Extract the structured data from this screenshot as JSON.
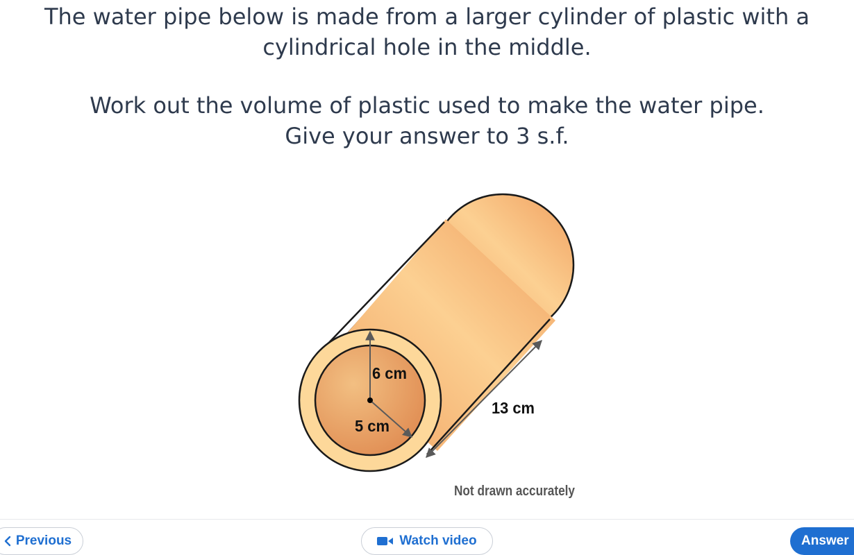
{
  "question": {
    "line1": "The water pipe below is made from a larger cylinder of plastic with a",
    "line2": "cylindrical hole in the middle.",
    "line3": "Work out the volume of plastic used to make the water pipe.",
    "line4": "Give your answer to 3 s.f."
  },
  "diagram": {
    "outer_radius_label": "6 cm",
    "inner_radius_label": "5 cm",
    "length_label": "13 cm",
    "note": "Not drawn accurately"
  },
  "nav": {
    "previous_label": "Previous",
    "previous_icon": "chevron-left-icon",
    "video_label": "Watch video",
    "video_icon": "video-camera-icon",
    "answer_label": "Answer"
  },
  "colors": {
    "accent": "#1f6fd1",
    "pipe_body": "#f0a15f",
    "pipe_face": "#fdd89a",
    "pipe_hole": "#e9a36a"
  }
}
